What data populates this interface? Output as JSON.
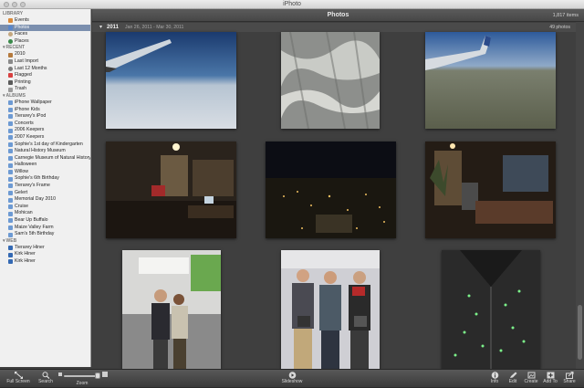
{
  "window": {
    "title": "iPhoto"
  },
  "sidebar": {
    "library_header": "LIBRARY",
    "library": [
      {
        "label": "Events",
        "icon": "events-icon",
        "selected": false
      },
      {
        "label": "Photos",
        "icon": "photos-icon",
        "selected": true
      },
      {
        "label": "Faces",
        "icon": "faces-icon",
        "selected": false
      },
      {
        "label": "Places",
        "icon": "places-icon",
        "selected": false
      }
    ],
    "recent_header": "RECENT",
    "recent": [
      {
        "label": "2010",
        "icon": "event-icon"
      },
      {
        "label": "Last Import",
        "icon": "import-icon"
      },
      {
        "label": "Last 12 Months",
        "icon": "clock-icon"
      },
      {
        "label": "Flagged",
        "icon": "flag-icon"
      },
      {
        "label": "Printing",
        "icon": "print-icon"
      },
      {
        "label": "Trash",
        "icon": "trash-icon"
      }
    ],
    "albums_header": "ALBUMS",
    "albums": [
      "iPhone Wallpaper",
      "iPhone Kids",
      "Tierarey's iPod",
      "Concerts",
      "2006 Keepers",
      "2007 Keepers",
      "Sophie's 1st day of Kindergarten",
      "Natural History Museum",
      "Carnegie Museum of Natural History",
      "Halloween",
      "Willow",
      "Sophie's 6th Birthday",
      "Tierarey's Frame",
      "Gelert",
      "Memorial Day 2010",
      "Cruise",
      "Mohican",
      "Bear Up Buffalo",
      "Maize Valley Farm",
      "Sam's 5th Birthday"
    ],
    "web_header": "WEB",
    "web": [
      "Tierarey Hiner",
      "Kirk Hiner",
      "Kirk Hiner"
    ]
  },
  "header": {
    "title": "Photos",
    "count": "1,817 items"
  },
  "content": {
    "year": "2011",
    "range": "Jan 26, 2011 - Mar 30, 2011",
    "photo_count": "49 photos"
  },
  "toolbar": {
    "left": [
      {
        "label": "Full Screen",
        "icon": "fullscreen-icon"
      },
      {
        "label": "Search",
        "icon": "search-icon"
      },
      {
        "label": "Zoom",
        "icon": "zoom-slider"
      }
    ],
    "center": [
      {
        "label": "Slideshow",
        "icon": "play-icon"
      }
    ],
    "right": [
      {
        "label": "Info",
        "icon": "info-icon"
      },
      {
        "label": "Edit",
        "icon": "pencil-icon"
      },
      {
        "label": "Create",
        "icon": "create-icon"
      },
      {
        "label": "Add To",
        "icon": "add-icon"
      },
      {
        "label": "Share",
        "icon": "share-icon"
      }
    ]
  },
  "colors": {
    "sidebar_bg": "#f0f0f0",
    "selection": "#7b8fae",
    "content_bg": "#3f3f3f",
    "toolbar_bg": "#4a4a4a"
  }
}
